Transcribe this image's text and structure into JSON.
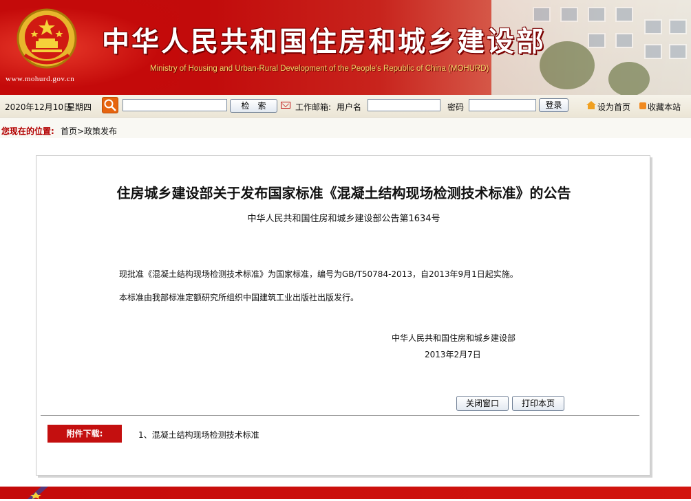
{
  "header": {
    "cn_title": "中华人民共和国住房和城乡建设部",
    "en_title": "Ministry of Housing and Urban-Rural Development of the People's Republic of China (MOHURD)",
    "site_url": "www.mohurd.gov.cn"
  },
  "toolbar": {
    "date": "2020年12月10日",
    "weekday": "星期四",
    "search_button": "检　索",
    "email_label": "工作邮箱:",
    "username_label": "用户名",
    "password_label": "密码",
    "login_button": "登录",
    "set_homepage": "设为首页",
    "bookmark": "收藏本站"
  },
  "location": {
    "label": "您现在的位置:",
    "crumbs": "首页>政策发布"
  },
  "article": {
    "title": "住房城乡建设部关于发布国家标准《混凝土结构现场检测技术标准》的公告",
    "subtitle": "中华人民共和国住房和城乡建设部公告第1634号",
    "paragraphs": [
      "现批准《混凝土结构现场检测技术标准》为国家标准，编号为GB/T50784-2013，自2013年9月1日起实施。",
      "本标准由我部标准定额研究所组织中国建筑工业出版社出版发行。"
    ],
    "signature": "中华人民共和国住房和城乡建设部",
    "date": "2013年2月7日",
    "close_button": "关闭窗口",
    "print_button": "打印本页",
    "attachments_label": "附件下载:",
    "attachments": [
      "1、混凝土结构现场检测技术标准"
    ]
  },
  "colors": {
    "brand_red": "#c40a0a",
    "gold": "#f4d86a"
  }
}
